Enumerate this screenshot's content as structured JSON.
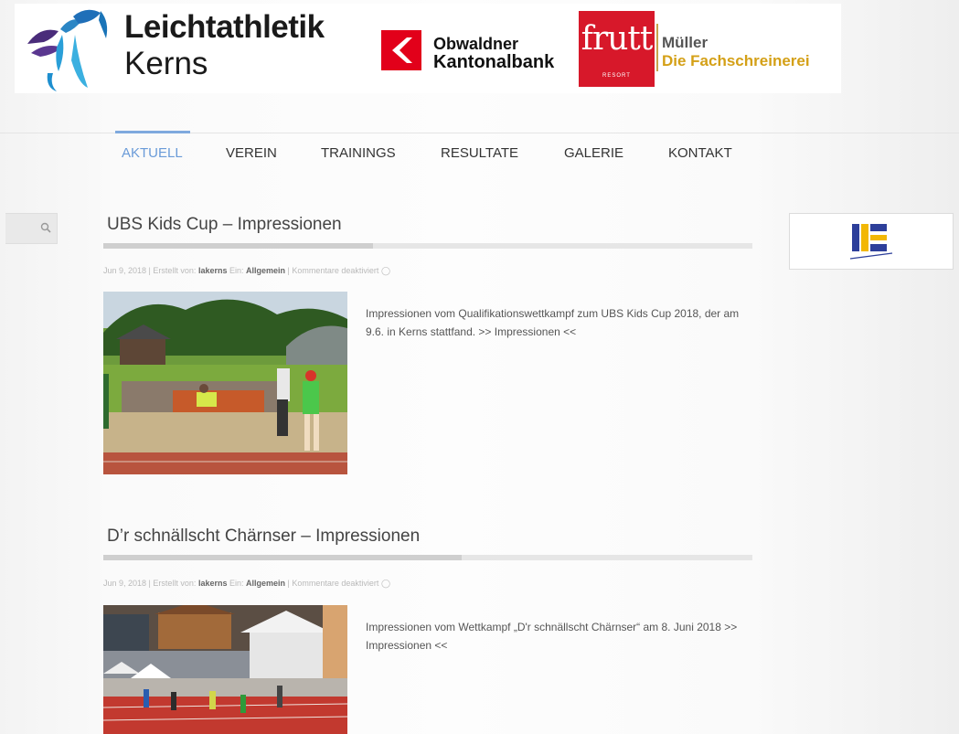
{
  "header": {
    "logo_line1": "Leichtathletik",
    "logo_line2": "Kerns",
    "sponsor1_line1": "Obwaldner",
    "sponsor1_line2": "Kantonalbank",
    "sponsor2_word": "frutt",
    "sponsor2_sub": "RESORT",
    "sponsor3_line1": "Müller",
    "sponsor3_line2": "Die Fachschreinerei"
  },
  "nav": {
    "items": [
      {
        "label": "AKTUELL",
        "active": true
      },
      {
        "label": "VEREIN",
        "active": false
      },
      {
        "label": "TRAININGS",
        "active": false
      },
      {
        "label": "RESULTATE",
        "active": false
      },
      {
        "label": "GALERIE",
        "active": false
      },
      {
        "label": "KONTAKT",
        "active": false
      }
    ],
    "active_color": "#6a9bd8"
  },
  "sidebar": {
    "search_icon": "search-icon",
    "sponsor_logo": "sponsor-logo"
  },
  "posts": [
    {
      "title": "UBS Kids Cup – Impressionen",
      "meta": {
        "date": "Jun 9, 2018",
        "created_by_label": "Erstellt von:",
        "author": "lakerns",
        "in_label": "Ein:",
        "category": "Allgemein",
        "comments": "Kommentare deaktiviert"
      },
      "excerpt": "Impressionen vom Qualifikationswettkampf zum UBS Kids Cup 2018, der am 9.6. in Kerns stattfand. >> Impressionen <<",
      "image": "long-jump-photo"
    },
    {
      "title": "D’r schnällscht Chärnser – Impressionen",
      "meta": {
        "date": "Jun 9, 2018",
        "created_by_label": "Erstellt von:",
        "author": "lakerns",
        "in_label": "Ein:",
        "category": "Allgemein",
        "comments": "Kommentare deaktiviert"
      },
      "excerpt": "Impressionen vom Wettkampf „D'r schnällscht Chärnser“ am 8. Juni 2018 >> Impressionen <<",
      "image": "sprint-race-photo"
    }
  ]
}
